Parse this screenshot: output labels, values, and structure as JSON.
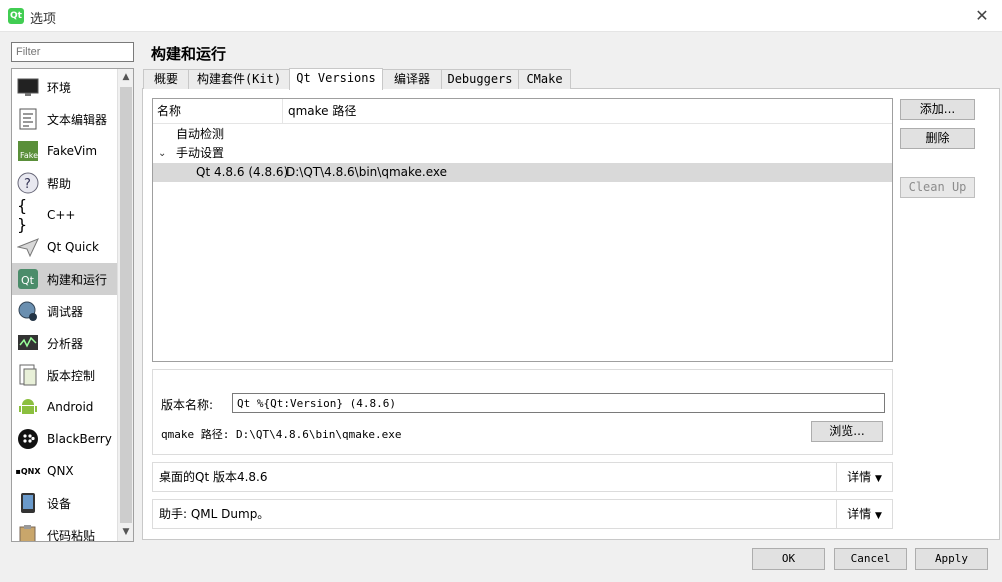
{
  "window": {
    "title": "选项",
    "app_icon": "Qt",
    "close_icon": "close-icon"
  },
  "filter": {
    "placeholder": "Filter"
  },
  "nav": {
    "items": [
      {
        "label": "环境",
        "icon": "monitor-icon"
      },
      {
        "label": "文本编辑器",
        "icon": "text-editor-icon"
      },
      {
        "label": "FakeVim",
        "icon": "fakevim-icon"
      },
      {
        "label": "帮助",
        "icon": "help-icon"
      },
      {
        "label": "C++",
        "icon": "braces-icon"
      },
      {
        "label": "Qt Quick",
        "icon": "paper-plane-icon"
      },
      {
        "label": "构建和运行",
        "icon": "qt-build-icon",
        "selected": true
      },
      {
        "label": "调试器",
        "icon": "debugger-icon"
      },
      {
        "label": "分析器",
        "icon": "analyzer-icon"
      },
      {
        "label": "版本控制",
        "icon": "version-control-icon"
      },
      {
        "label": "Android",
        "icon": "android-icon"
      },
      {
        "label": "BlackBerry",
        "icon": "blackberry-icon"
      },
      {
        "label": "QNX",
        "icon": "qnx-icon"
      },
      {
        "label": "设备",
        "icon": "device-icon"
      },
      {
        "label": "代码粘贴",
        "icon": "code-paste-icon"
      }
    ]
  },
  "page": {
    "title": "构建和运行"
  },
  "tabs": [
    {
      "label": "概要"
    },
    {
      "label": "构建套件(Kit)"
    },
    {
      "label": "Qt Versions",
      "active": true
    },
    {
      "label": "编译器"
    },
    {
      "label": "Debuggers"
    },
    {
      "label": "CMake"
    }
  ],
  "tree": {
    "headers": [
      "名称",
      "qmake 路径"
    ],
    "groups": [
      "自动检测",
      "手动设置"
    ],
    "expand_icon": "chevron-down-icon",
    "rows": [
      {
        "name": "Qt 4.8.6 (4.8.6)",
        "path": "D:\\QT\\4.8.6\\bin\\qmake.exe"
      }
    ]
  },
  "buttons": {
    "add": "添加...",
    "remove": "删除",
    "cleanup": "Clean Up"
  },
  "version_detail": {
    "name_label": "版本名称:",
    "name_value": "Qt %{Qt:Version} (4.8.6)",
    "qmake_label": "qmake 路径:",
    "qmake_value": "D:\\QT\\4.8.6\\bin\\qmake.exe",
    "browse": "浏览..."
  },
  "desktop": {
    "text": "桌面的Qt 版本4.8.6",
    "details": "详情"
  },
  "helper": {
    "text": "助手: QML Dump。",
    "details": "详情"
  },
  "dialog": {
    "ok": "OK",
    "cancel": "Cancel",
    "apply": "Apply"
  },
  "colors": {
    "selected_nav": "#d0d0d0",
    "selected_row": "#d9d9d9",
    "qt_green": "#41cd52"
  }
}
